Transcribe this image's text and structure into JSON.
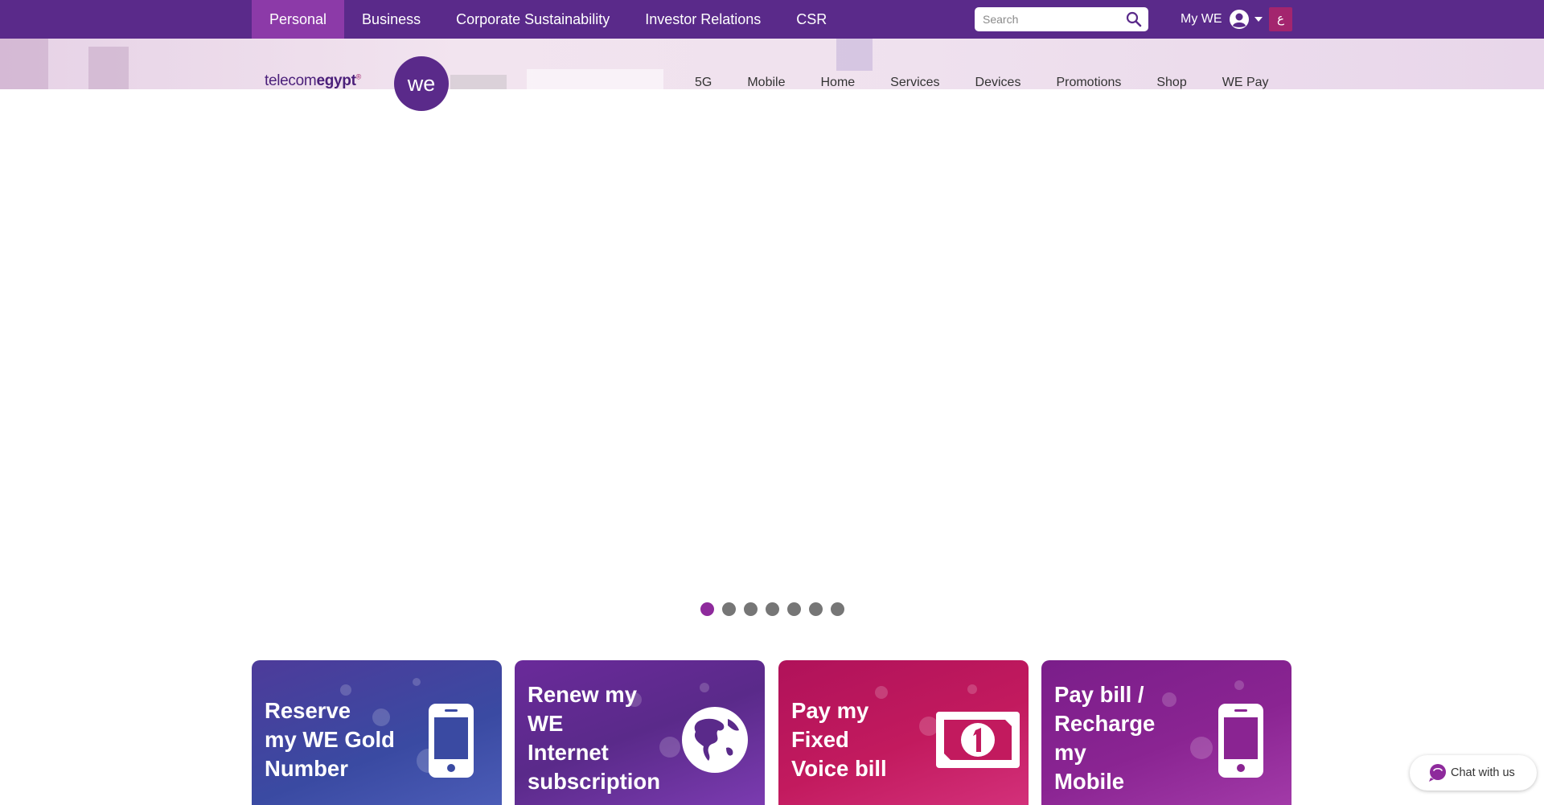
{
  "colors": {
    "brand_purple": "#5a2a8a",
    "active_tab": "#8c3aa8",
    "lang_badge": "#a3256e",
    "dot_active": "#8e2a9c",
    "dot_inactive": "#767676"
  },
  "topnav": {
    "items": [
      {
        "label": "Personal",
        "active": true
      },
      {
        "label": "Business"
      },
      {
        "label": "Corporate Sustainability"
      },
      {
        "label": "Investor Relations"
      },
      {
        "label": "CSR"
      }
    ]
  },
  "search": {
    "placeholder": "Search",
    "value": "",
    "icon": "search-icon"
  },
  "account": {
    "label": "My WE",
    "icon": "user-icon",
    "caret": "chevron-down-icon"
  },
  "language": {
    "label": "ع"
  },
  "logo": {
    "text_light": "telecom",
    "text_bold": "egypt",
    "mark": "®",
    "circle_text": "we"
  },
  "mainnav": {
    "items": [
      "5G",
      "Mobile",
      "Home",
      "Services",
      "Devices",
      "Promotions",
      "Shop",
      "WE Pay"
    ]
  },
  "carousel": {
    "slide_count": 7,
    "active_index": 0
  },
  "cards": [
    {
      "lines": [
        "Reserve",
        "my WE Gold",
        "Number"
      ],
      "icon": "phone-icon"
    },
    {
      "lines": [
        "Renew my",
        "WE",
        "Internet",
        "subscription"
      ],
      "icon": "globe-icon"
    },
    {
      "lines": [
        "Pay my",
        "Fixed",
        "Voice bill"
      ],
      "icon": "banknote-icon"
    },
    {
      "lines": [
        "Pay bill /",
        "Recharge",
        "my",
        "Mobile"
      ],
      "icon": "phone-icon"
    }
  ],
  "chat": {
    "label": "Chat with us",
    "icon": "chat-bubble-icon"
  }
}
